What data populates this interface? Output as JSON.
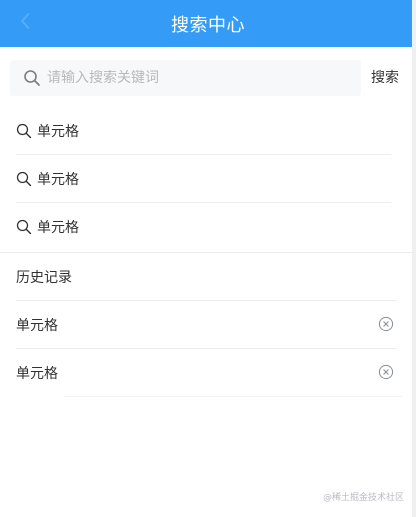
{
  "navbar": {
    "title": "搜索中心",
    "back_icon": "chevron-left-icon",
    "color": "#349cf7"
  },
  "search": {
    "placeholder": "请输入搜索关键词",
    "value": "",
    "action_label": "搜索",
    "icon": "search-icon"
  },
  "suggestions": [
    {
      "label": "单元格",
      "icon": "search-icon"
    },
    {
      "label": "单元格",
      "icon": "search-icon"
    },
    {
      "label": "单元格",
      "icon": "search-icon"
    }
  ],
  "history": {
    "title": "历史记录",
    "items": [
      {
        "label": "单元格",
        "icon": "clear-icon"
      },
      {
        "label": "单元格",
        "icon": "clear-icon"
      }
    ]
  },
  "watermark": "@稀土掘金技术社区"
}
